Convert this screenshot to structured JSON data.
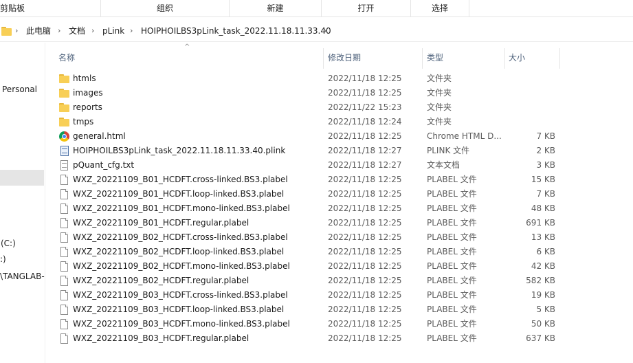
{
  "ribbon": {
    "groups": [
      "剪贴板",
      "组织",
      "新建",
      "打开",
      "选择"
    ]
  },
  "breadcrumb": {
    "items": [
      "此电脑",
      "文档",
      "pLink",
      "HOIPHOILBS3pLink_task_2022.11.18.11.33.40"
    ],
    "separator": "›"
  },
  "nav": {
    "items": [
      "Personal",
      "(C:)",
      ":)",
      "\\TANGLAB-"
    ]
  },
  "columns": {
    "name": "名称",
    "date": "修改日期",
    "type": "类型",
    "size": "大小",
    "sort_icon": "^"
  },
  "files": [
    {
      "name": "htmls",
      "date": "2022/11/18 12:25",
      "type": "文件夹",
      "size": "",
      "icon": "folder-icon"
    },
    {
      "name": "images",
      "date": "2022/11/18 12:25",
      "type": "文件夹",
      "size": "",
      "icon": "folder-icon"
    },
    {
      "name": "reports",
      "date": "2022/11/22 15:23",
      "type": "文件夹",
      "size": "",
      "icon": "folder-icon"
    },
    {
      "name": "tmps",
      "date": "2022/11/18 12:24",
      "type": "文件夹",
      "size": "",
      "icon": "folder-icon"
    },
    {
      "name": "general.html",
      "date": "2022/11/18 12:25",
      "type": "Chrome HTML D...",
      "size": "7 KB",
      "icon": "chrome-icon"
    },
    {
      "name": "HOIPHOILBS3pLink_task_2022.11.18.11.33.40.plink",
      "date": "2022/11/18 12:27",
      "type": "PLINK 文件",
      "size": "2 KB",
      "icon": "plink-file-icon"
    },
    {
      "name": "pQuant_cfg.txt",
      "date": "2022/11/18 12:27",
      "type": "文本文档",
      "size": "3 KB",
      "icon": "text-file-icon"
    },
    {
      "name": "WXZ_20221109_B01_HCDFT.cross-linked.BS3.plabel",
      "date": "2022/11/18 12:25",
      "type": "PLABEL 文件",
      "size": "15 KB",
      "icon": "file-icon"
    },
    {
      "name": "WXZ_20221109_B01_HCDFT.loop-linked.BS3.plabel",
      "date": "2022/11/18 12:25",
      "type": "PLABEL 文件",
      "size": "7 KB",
      "icon": "file-icon"
    },
    {
      "name": "WXZ_20221109_B01_HCDFT.mono-linked.BS3.plabel",
      "date": "2022/11/18 12:25",
      "type": "PLABEL 文件",
      "size": "48 KB",
      "icon": "file-icon"
    },
    {
      "name": "WXZ_20221109_B01_HCDFT.regular.plabel",
      "date": "2022/11/18 12:25",
      "type": "PLABEL 文件",
      "size": "691 KB",
      "icon": "file-icon"
    },
    {
      "name": "WXZ_20221109_B02_HCDFT.cross-linked.BS3.plabel",
      "date": "2022/11/18 12:25",
      "type": "PLABEL 文件",
      "size": "13 KB",
      "icon": "file-icon"
    },
    {
      "name": "WXZ_20221109_B02_HCDFT.loop-linked.BS3.plabel",
      "date": "2022/11/18 12:25",
      "type": "PLABEL 文件",
      "size": "6 KB",
      "icon": "file-icon"
    },
    {
      "name": "WXZ_20221109_B02_HCDFT.mono-linked.BS3.plabel",
      "date": "2022/11/18 12:25",
      "type": "PLABEL 文件",
      "size": "42 KB",
      "icon": "file-icon"
    },
    {
      "name": "WXZ_20221109_B02_HCDFT.regular.plabel",
      "date": "2022/11/18 12:25",
      "type": "PLABEL 文件",
      "size": "582 KB",
      "icon": "file-icon"
    },
    {
      "name": "WXZ_20221109_B03_HCDFT.cross-linked.BS3.plabel",
      "date": "2022/11/18 12:25",
      "type": "PLABEL 文件",
      "size": "19 KB",
      "icon": "file-icon"
    },
    {
      "name": "WXZ_20221109_B03_HCDFT.loop-linked.BS3.plabel",
      "date": "2022/11/18 12:25",
      "type": "PLABEL 文件",
      "size": "5 KB",
      "icon": "file-icon"
    },
    {
      "name": "WXZ_20221109_B03_HCDFT.mono-linked.BS3.plabel",
      "date": "2022/11/18 12:25",
      "type": "PLABEL 文件",
      "size": "50 KB",
      "icon": "file-icon"
    },
    {
      "name": "WXZ_20221109_B03_HCDFT.regular.plabel",
      "date": "2022/11/18 12:25",
      "type": "PLABEL 文件",
      "size": "637 KB",
      "icon": "file-icon"
    }
  ]
}
